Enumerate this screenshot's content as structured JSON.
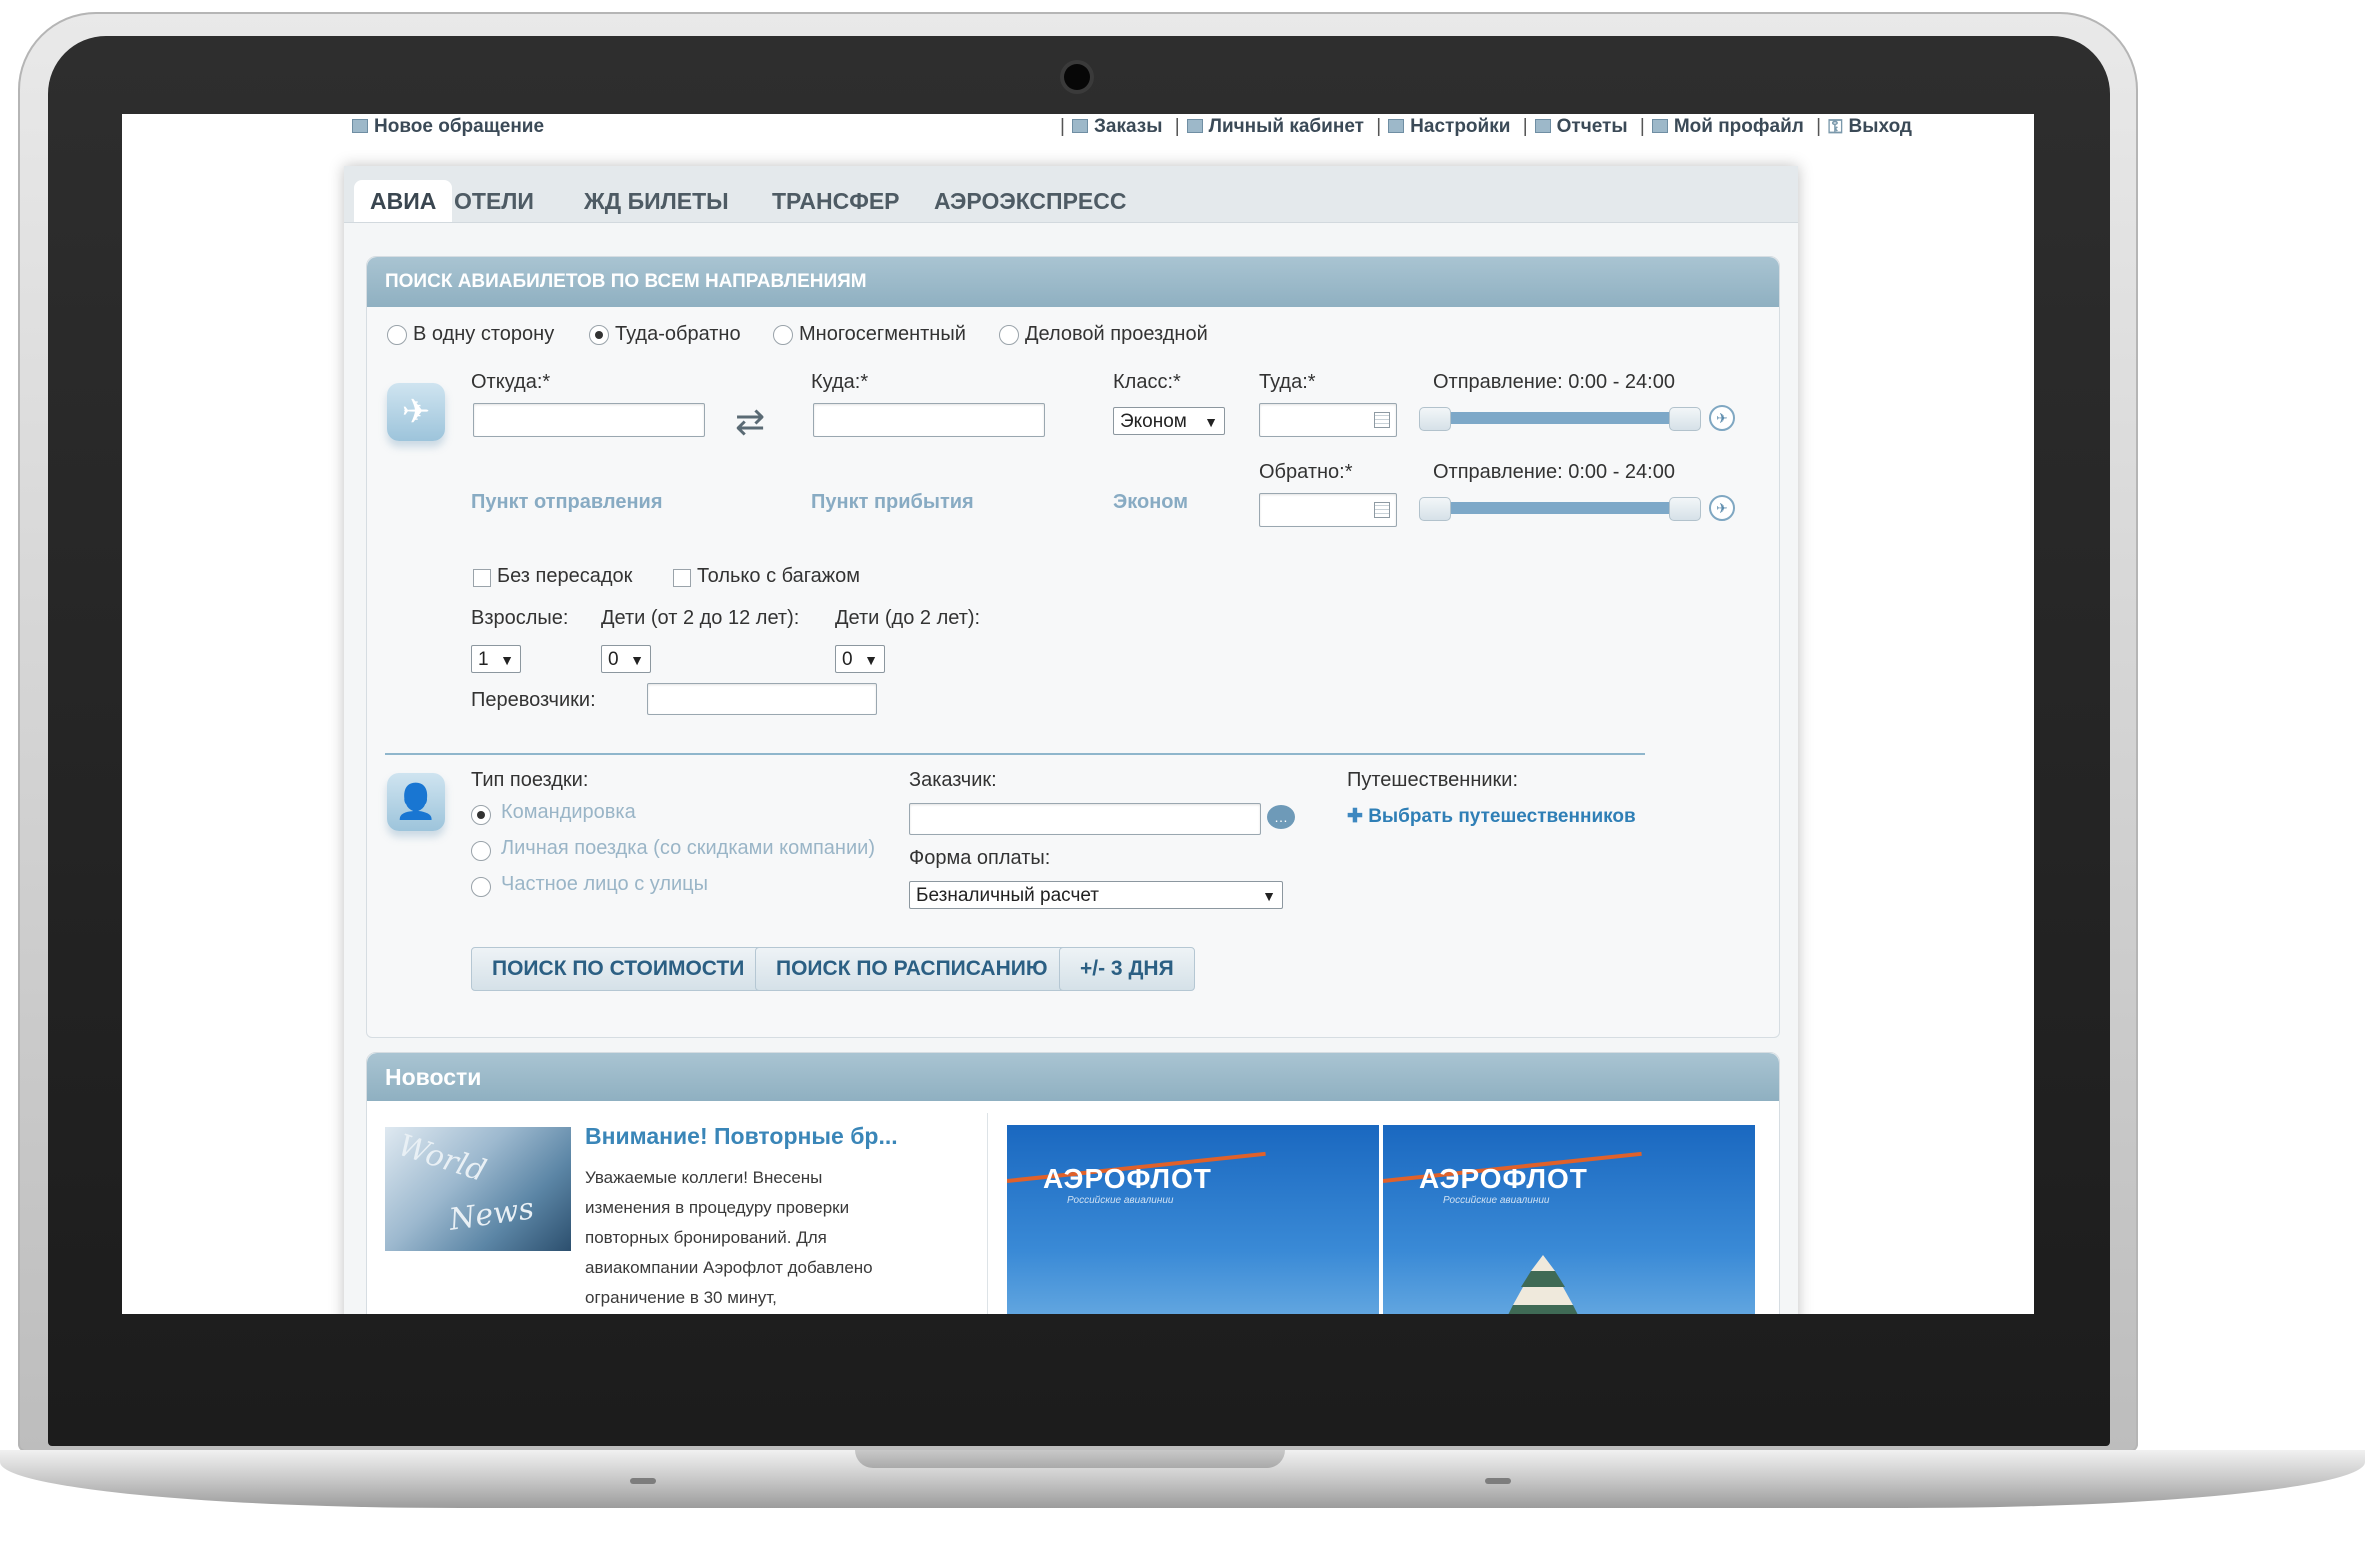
{
  "topbar": {
    "new_request": "Новое обращение",
    "links": [
      "Заказы",
      "Личный кабинет",
      "Настройки",
      "Отчеты",
      "Мой профайл",
      "Выход"
    ]
  },
  "tabs": [
    "АВИА",
    "ОТЕЛИ",
    "ЖД БИЛЕТЫ",
    "ТРАНСФЕР",
    "АЭРОЭКСПРЕСС"
  ],
  "search": {
    "title": "ПОИСК АВИАБИЛЕТОВ ПО ВСЕМ НАПРАВЛЕНИЯМ",
    "trip_options": [
      "В одну сторону",
      "Туда-обратно",
      "Многосегментный",
      "Деловой проездной"
    ],
    "selected_trip": "Туда-обратно",
    "from_label": "Откуда:*",
    "to_label": "Куда:*",
    "class_label": "Класс:*",
    "class_value": "Эконом",
    "depart_label": "Туда:*",
    "return_label": "Обратно:*",
    "departure_range_label": "Отправление: 0:00 - 24:00",
    "return_range_label": "Отправление: 0:00 - 24:00",
    "from_hint": "Пункт отправления",
    "to_hint": "Пункт прибытия",
    "class_hint": "Эконом",
    "nonstop_label": "Без пересадок",
    "baggage_label": "Только с багажом",
    "adults_label": "Взрослые:",
    "children_label": "Дети (от 2 до 12 лет):",
    "infants_label": "Дети (до 2 лет):",
    "adults_value": "1",
    "children_value": "0",
    "infants_value": "0",
    "carriers_label": "Перевозчики:",
    "trip_type_label": "Тип поездки:",
    "trip_types": [
      "Командировка",
      "Личная поездка (со скидками компании)",
      "Частное лицо с улицы"
    ],
    "customer_label": "Заказчик:",
    "payment_label": "Форма оплаты:",
    "payment_value": "Безналичный расчет",
    "travelers_label": "Путешественники:",
    "choose_travelers": "Выбрать путешественников",
    "buttons": [
      "ПОИСК ПО СТОИМОСТИ",
      "ПОИСК ПО РАСПИСАНИЮ",
      "+/- 3 ДНЯ"
    ]
  },
  "news": {
    "title": "Новости",
    "item_title": "Внимание! Повторные бр...",
    "item_text": "Уважаемые коллеги! Внесены изменения в процедуру проверки повторных бронирований. Для авиакомпании Аэрофлот добавлено ограничение в 30 минут,",
    "image_words": [
      "World",
      "News"
    ],
    "banner_logo": "АЭРОФЛОТ",
    "banner_sub": "Российские авиалинии"
  }
}
